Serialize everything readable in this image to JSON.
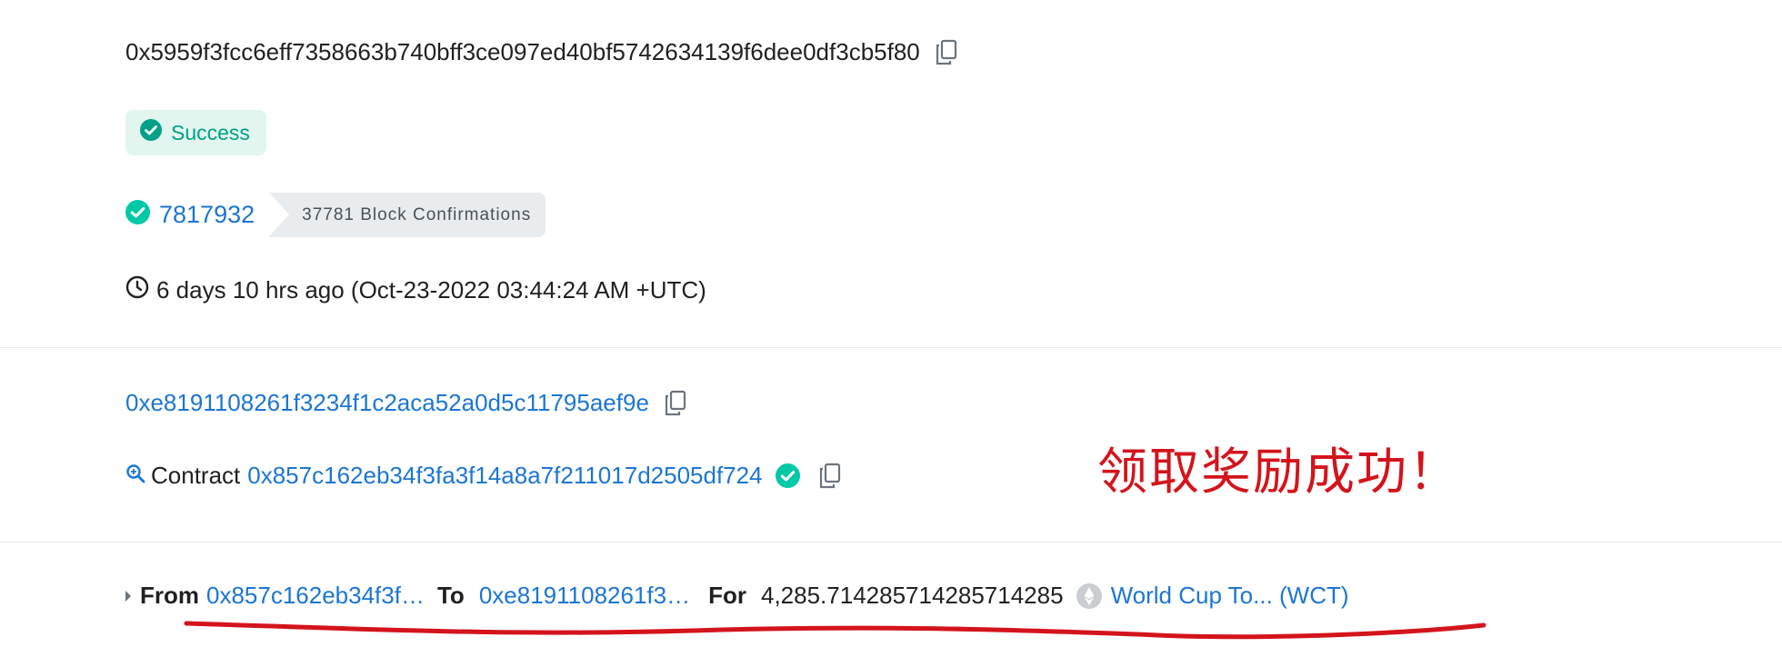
{
  "tx_hash": "0x5959f3fcc6eff7358663b740bff3ce097ed40bf5742634139f6dee0df3cb5f80",
  "status": "Success",
  "block": {
    "number": "7817932",
    "confirmations": "37781 Block Confirmations"
  },
  "timestamp": "6 days 10 hrs ago (Oct-23-2022 03:44:24 AM +UTC)",
  "from": "0xe8191108261f3234f1c2aca52a0d5c11795aef9e",
  "interacted_with": {
    "label": "Contract",
    "address": "0x857c162eb34f3fa3f14a8a7f211017d2505df724"
  },
  "annotation": "领取奖励成功！",
  "transfer": {
    "from_label": "From",
    "from_addr": "0x857c162eb34f3f…",
    "to_label": "To",
    "to_addr": "0xe8191108261f3…",
    "for_label": "For",
    "amount": "4,285.714285714285714285",
    "token": "World Cup To... (WCT)"
  },
  "colors": {
    "link": "#1b76d3",
    "success": "#00a186",
    "success_bg": "#e2f6ef",
    "annotation": "#d4141c"
  },
  "icons": [
    "copy-icon",
    "check-circle-icon",
    "clock-icon",
    "zoom-icon",
    "ethereum-icon",
    "caret-right-icon"
  ]
}
